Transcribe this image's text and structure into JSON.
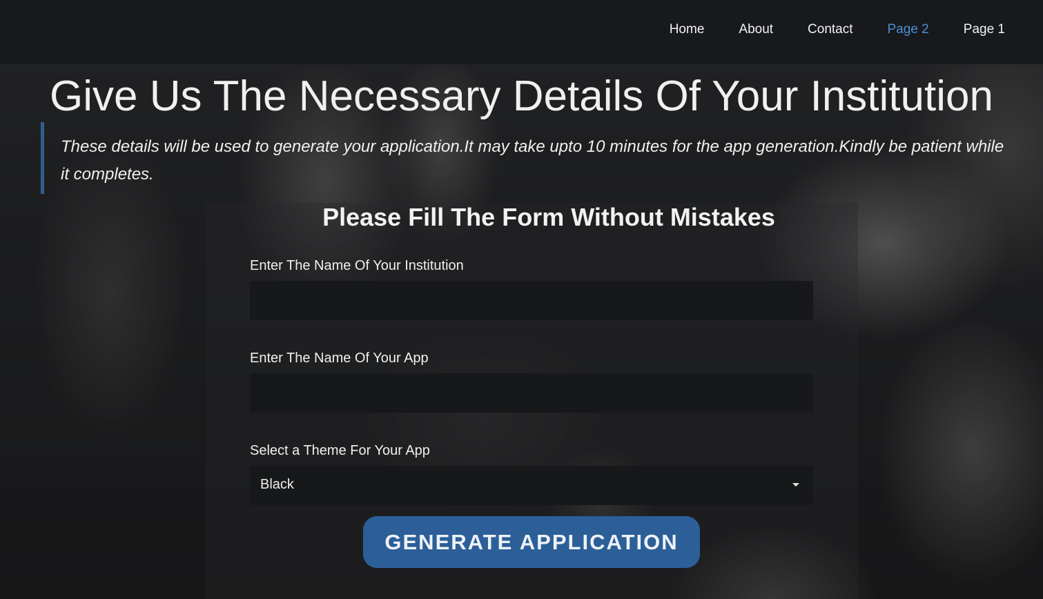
{
  "nav": {
    "items": [
      {
        "label": "Home",
        "active": false
      },
      {
        "label": "About",
        "active": false
      },
      {
        "label": "Contact",
        "active": false
      },
      {
        "label": "Page 2",
        "active": true
      },
      {
        "label": "Page 1",
        "active": false
      }
    ]
  },
  "hero": {
    "title": "Give Us The Necessary Details Of Your Institution",
    "description": "These details will be used to generate your application.It may take upto 10 minutes for the app generation.Kindly be patient while it completes."
  },
  "form": {
    "heading": "Please Fill The Form Without Mistakes",
    "institution_label": "Enter The Name Of Your Institution",
    "institution_value": "",
    "app_label": "Enter The Name Of Your App",
    "app_value": "",
    "theme_label": "Select a Theme For Your App",
    "theme_selected": "Black",
    "submit_label": "GENERATE APPLICATION"
  },
  "colors": {
    "accent": "#2c5f98",
    "active_nav": "#4a8fd6",
    "navbar_bg": "#17191c"
  }
}
